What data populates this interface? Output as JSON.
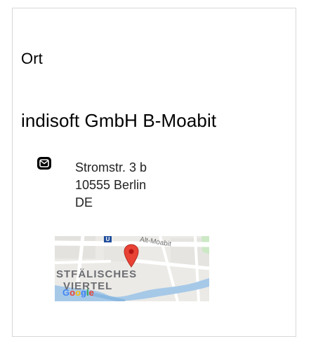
{
  "section": {
    "label": "Ort"
  },
  "location": {
    "name": "indisoft GmbH B-Moabit",
    "address_lines": [
      "Stromstr. 3 b",
      "10555 Berlin",
      "DE"
    ],
    "icon": "mail-icon"
  },
  "map": {
    "street_label": "Alt-Moabit",
    "district_line1": "STFÄLISCHES",
    "district_line2": "VIERTEL",
    "logo_text": "Google",
    "transit_label": "U"
  }
}
